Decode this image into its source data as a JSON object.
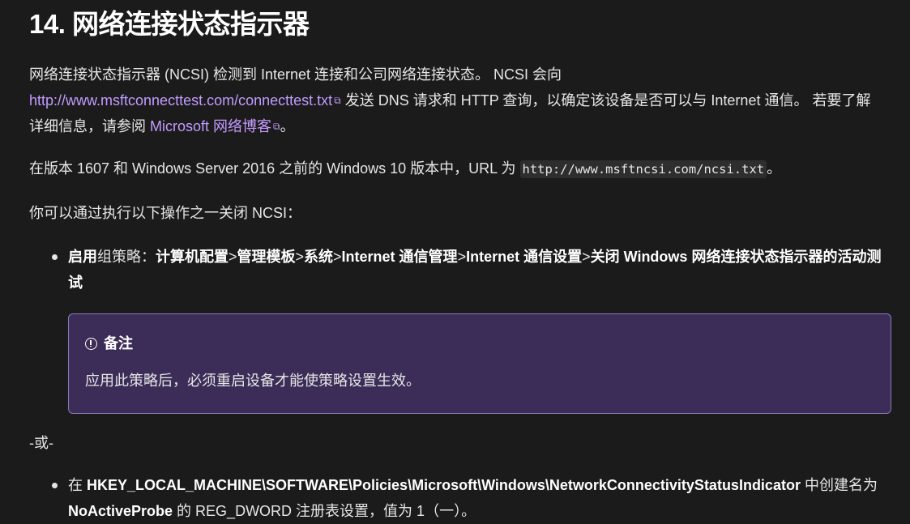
{
  "heading": "14. 网络连接状态指示器",
  "para1": {
    "t1": "网络连接状态指示器 (NCSI) 检测到 Internet 连接和公司网络连接状态。 NCSI 会向",
    "link1": "http://www.msftconnecttest.com/connecttest.txt",
    "t2": " 发送 DNS 请求和 HTTP 查询，以确定该设备是否可以与 Internet 通信。 若要了解详细信息，请参阅 ",
    "link2": "Microsoft 网络博客",
    "t3": "。"
  },
  "para2": {
    "t1": "在版本 1607 和 Windows Server 2016 之前的 Windows 10 版本中，URL 为 ",
    "code": "http://www.msftncsi.com/ncsi.txt",
    "t2": "。"
  },
  "para3": "你可以通过执行以下操作之一关闭 NCSI：",
  "bullet1": {
    "b1": "启用",
    "t1": "组策略：",
    "b2": "计算机配置",
    "s1": ">",
    "b3": "管理模板",
    "s2": ">",
    "b4": "系统",
    "s3": ">",
    "b5": "Internet 通信管理",
    "s4": ">",
    "b6": "Internet 通信设置",
    "s5": ">",
    "b7": "关闭 Windows 网络连接状态指示器的活动测试"
  },
  "note": {
    "title": "备注",
    "body": "应用此策略后，必须重启设备才能使策略设置生效。"
  },
  "or_text": "-或-",
  "bullet2": {
    "t1": "在 ",
    "b1": "HKEY_LOCAL_MACHINE\\SOFTWARE\\Policies\\Microsoft\\Windows\\NetworkConnectivityStatusIndicator",
    "t2": " 中创建名为 ",
    "b2": "NoActiveProbe",
    "t3": " 的 REG_DWORD 注册表设置，值为 1（一）。"
  },
  "icons": {
    "external_link": "external-link-icon",
    "info": "info-icon"
  },
  "colors": {
    "link": "#c39bff",
    "note_bg": "#3b2d58",
    "note_border": "#8a79b8",
    "background": "#1b1b1b"
  }
}
